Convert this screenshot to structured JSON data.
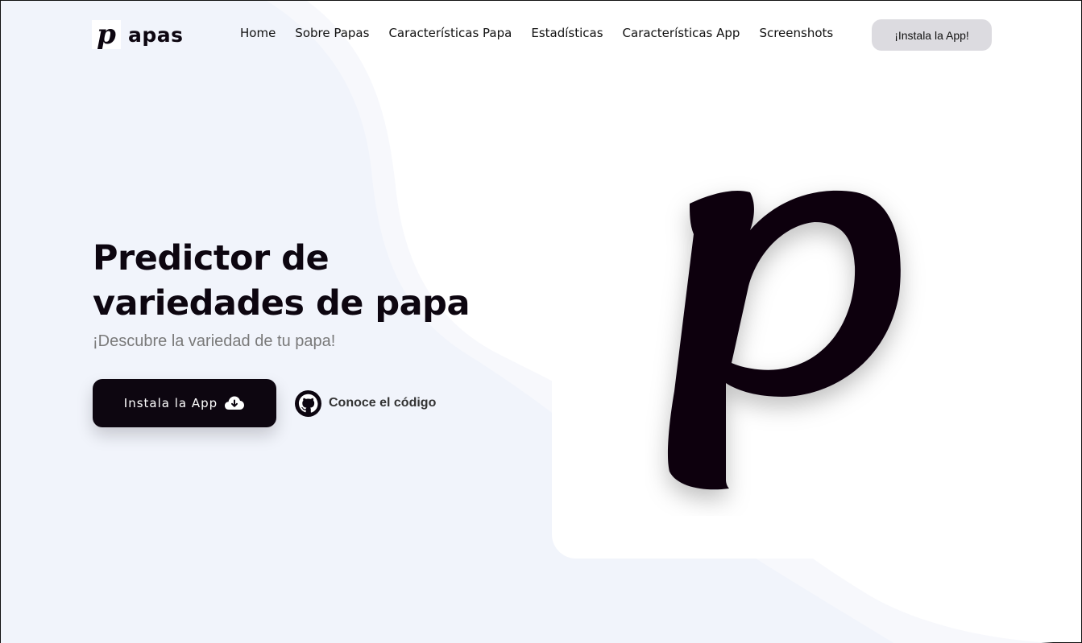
{
  "brand": {
    "mark": "p",
    "name": "apas"
  },
  "nav": {
    "items": [
      {
        "label": "Home"
      },
      {
        "label": "Sobre Papas"
      },
      {
        "label": "Características Papa"
      },
      {
        "label": "Estadísticas"
      },
      {
        "label": "Características App"
      },
      {
        "label": "Screenshots"
      }
    ],
    "install_label": "¡Instala la App!"
  },
  "hero": {
    "title": "Predictor de variedades de papa",
    "subtitle": "¡Descubre la variedad de tu papa!",
    "install_button_label": "Instala la App",
    "install_icon": "cloud-download-icon",
    "code_link_label": "Conoce el código",
    "code_icon": "github-icon",
    "logo_glyph": "p"
  },
  "colors": {
    "primary": "#0d0610",
    "background_tint": "#f1f4fb",
    "nav_button": "#dcdbe0",
    "subtitle": "#7a7a7a"
  }
}
